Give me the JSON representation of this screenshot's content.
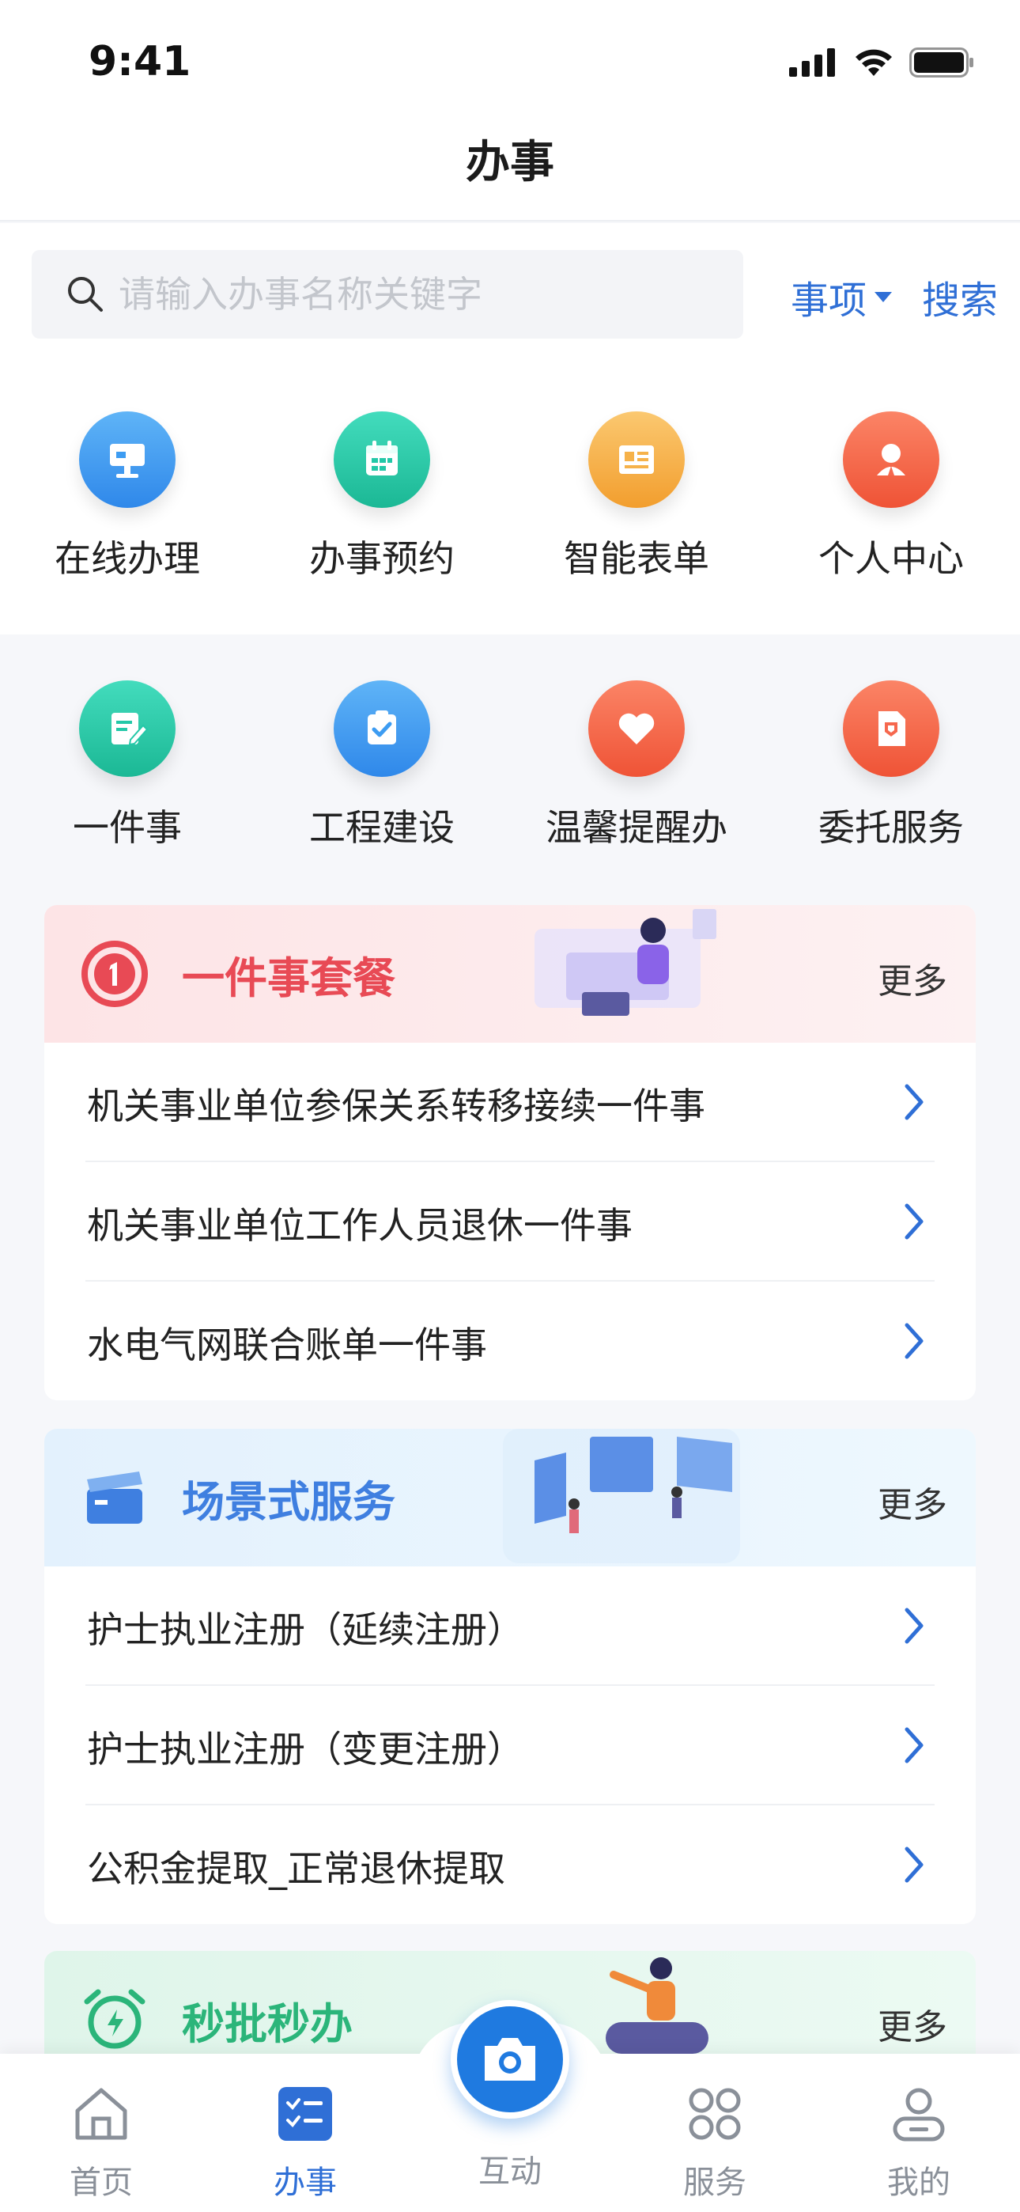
{
  "status_bar": {
    "time": "9:41"
  },
  "header": {
    "title": "办事"
  },
  "search": {
    "placeholder": "请输入办事名称关键字",
    "scope_label": "事项",
    "button_label": "搜索"
  },
  "quick_grid": [
    {
      "label": "在线办理",
      "icon": "monitor-icon",
      "color": "#3d9cf2"
    },
    {
      "label": "办事预约",
      "icon": "calendar-icon",
      "color": "#23c8a8"
    },
    {
      "label": "智能表单",
      "icon": "form-icon",
      "color": "#f6b24a"
    },
    {
      "label": "个人中心",
      "icon": "person-icon",
      "color": "#f6684e"
    },
    {
      "label": "一件事",
      "icon": "edit-icon",
      "color": "#23c8a8"
    },
    {
      "label": "工程建设",
      "icon": "check-icon",
      "color": "#3d9cf2"
    },
    {
      "label": "温馨提醒办",
      "icon": "heart-icon",
      "color": "#f6684e"
    },
    {
      "label": "委托服务",
      "icon": "document-shield-icon",
      "color": "#f6684e"
    }
  ],
  "sections": [
    {
      "title": "一件事套餐",
      "more": "更多",
      "title_color": "#e84a55",
      "items": [
        "机关事业单位参保关系转移接续一件事",
        "机关事业单位工作人员退休一件事",
        "水电气网联合账单一件事"
      ]
    },
    {
      "title": "场景式服务",
      "more": "更多",
      "title_color": "#3f7fe0",
      "items": [
        "护士执业注册（延续注册）",
        "护士执业注册（变更注册）",
        "公积金提取_正常退休提取"
      ]
    },
    {
      "title": "秒批秒办",
      "more": "更多",
      "title_color": "#2bb57a",
      "items": []
    }
  ],
  "tabbar": [
    {
      "label": "首页",
      "icon": "home-icon",
      "active": false
    },
    {
      "label": "办事",
      "icon": "tasks-icon",
      "active": true
    },
    {
      "label": "互动",
      "icon": "camera-icon",
      "active": false
    },
    {
      "label": "服务",
      "icon": "apps-icon",
      "active": false
    },
    {
      "label": "我的",
      "icon": "user-icon",
      "active": false
    }
  ],
  "colors": {
    "accent": "#2f6fd6",
    "page_bg": "#f6f7fa"
  }
}
